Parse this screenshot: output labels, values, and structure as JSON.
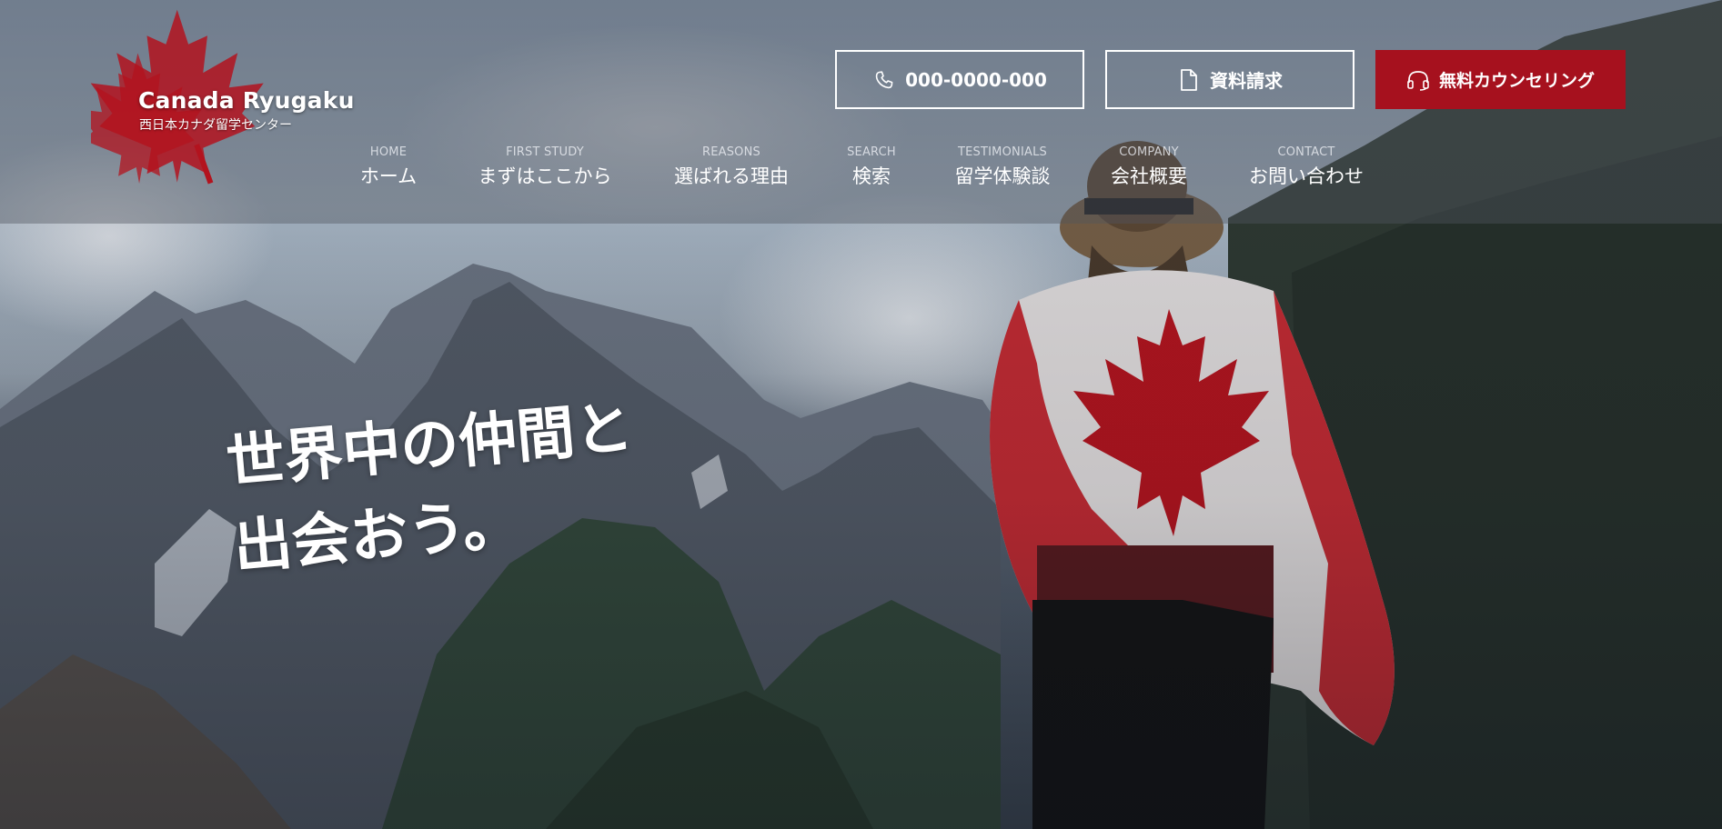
{
  "brand": {
    "name": "Canada Ryugaku",
    "subtitle": "西日本カナダ留学センター",
    "logo_icon": "maple-leaf-icon",
    "accent_color": "#a6111e"
  },
  "header_actions": {
    "phone": {
      "label": "000-0000-000",
      "icon": "phone-icon"
    },
    "documents": {
      "label": "資料請求",
      "icon": "document-icon"
    },
    "consultation": {
      "label": "無料カウンセリング",
      "icon": "headset-icon"
    }
  },
  "nav": {
    "items": [
      {
        "en": "HOME",
        "jp": "ホーム"
      },
      {
        "en": "FIRST STUDY",
        "jp": "まずはここから"
      },
      {
        "en": "REASONS",
        "jp": "選ばれる理由"
      },
      {
        "en": "SEARCH",
        "jp": "検索"
      },
      {
        "en": "TESTIMONIALS",
        "jp": "留学体験談"
      },
      {
        "en": "COMPANY",
        "jp": "会社概要"
      },
      {
        "en": "CONTACT",
        "jp": "お問い合わせ"
      }
    ]
  },
  "hero": {
    "headline_line1": "世界中の仲間と",
    "headline_line2": "出会おう。"
  }
}
